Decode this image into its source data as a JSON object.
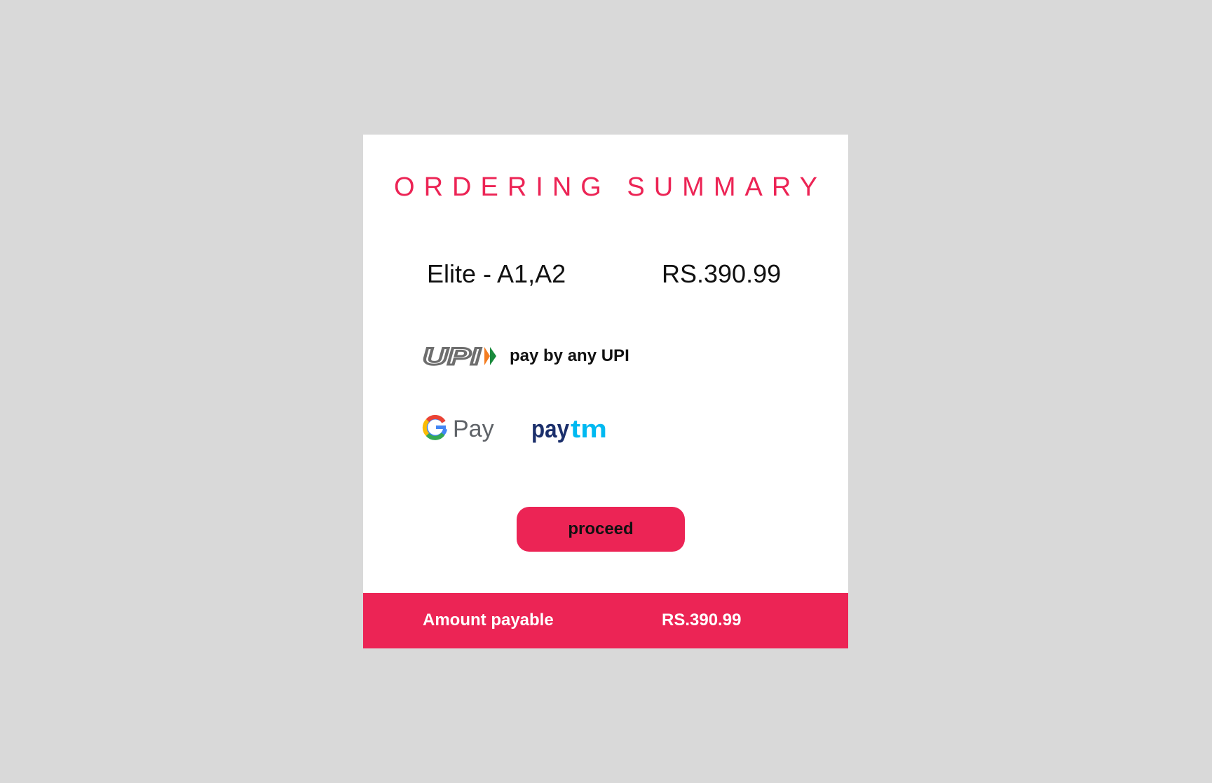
{
  "summary": {
    "title": "ORDERING SUMMARY",
    "item_name": "Elite - A1,A2",
    "item_price": "RS.390.99"
  },
  "payment": {
    "upi_logo_text": "UPI",
    "upi_label": "pay by any UPI",
    "gpay_logo_text": "Pay",
    "paytm_logo_text_pay": "pay",
    "paytm_logo_text_tm": "tm"
  },
  "actions": {
    "proceed_label": "proceed"
  },
  "footer": {
    "amount_label": "Amount payable",
    "amount_value": "RS.390.99"
  },
  "colors": {
    "accent": "#ec2455",
    "background": "#d9d9d9",
    "card": "#ffffff",
    "paytm_dark": "#1b2f6b",
    "paytm_light": "#00b9f1"
  }
}
